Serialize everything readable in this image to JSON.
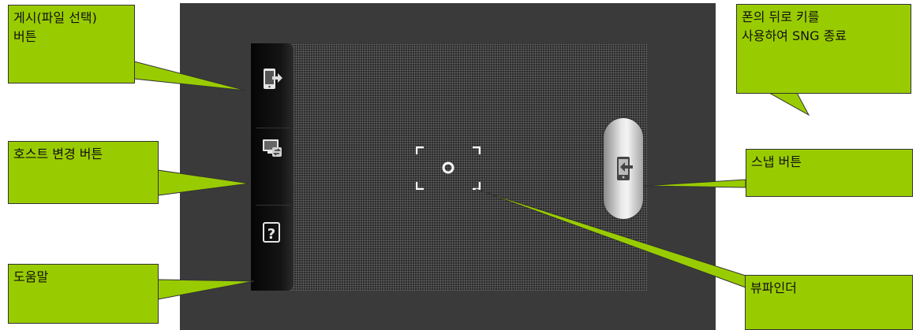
{
  "callouts": {
    "post_button": "게시(파일 선택)\n버튼",
    "host_change_button": "호스트 변경 버튼",
    "help": "도움말",
    "exit_sng": "폰의 뒤로 키를\n사용하여 SNG 종료",
    "snap_button": "스냅 버튼",
    "viewfinder": "뷰파인더"
  },
  "colors": {
    "callout_fill": "#99cc00",
    "frame": "#3a3a3a",
    "screen": "#2b2b2b"
  },
  "icons": {
    "post": "phone-export-icon",
    "host": "host-change-icon",
    "help": "question-icon",
    "snap": "phone-import-icon",
    "viewfinder": "focus-brackets-icon"
  }
}
